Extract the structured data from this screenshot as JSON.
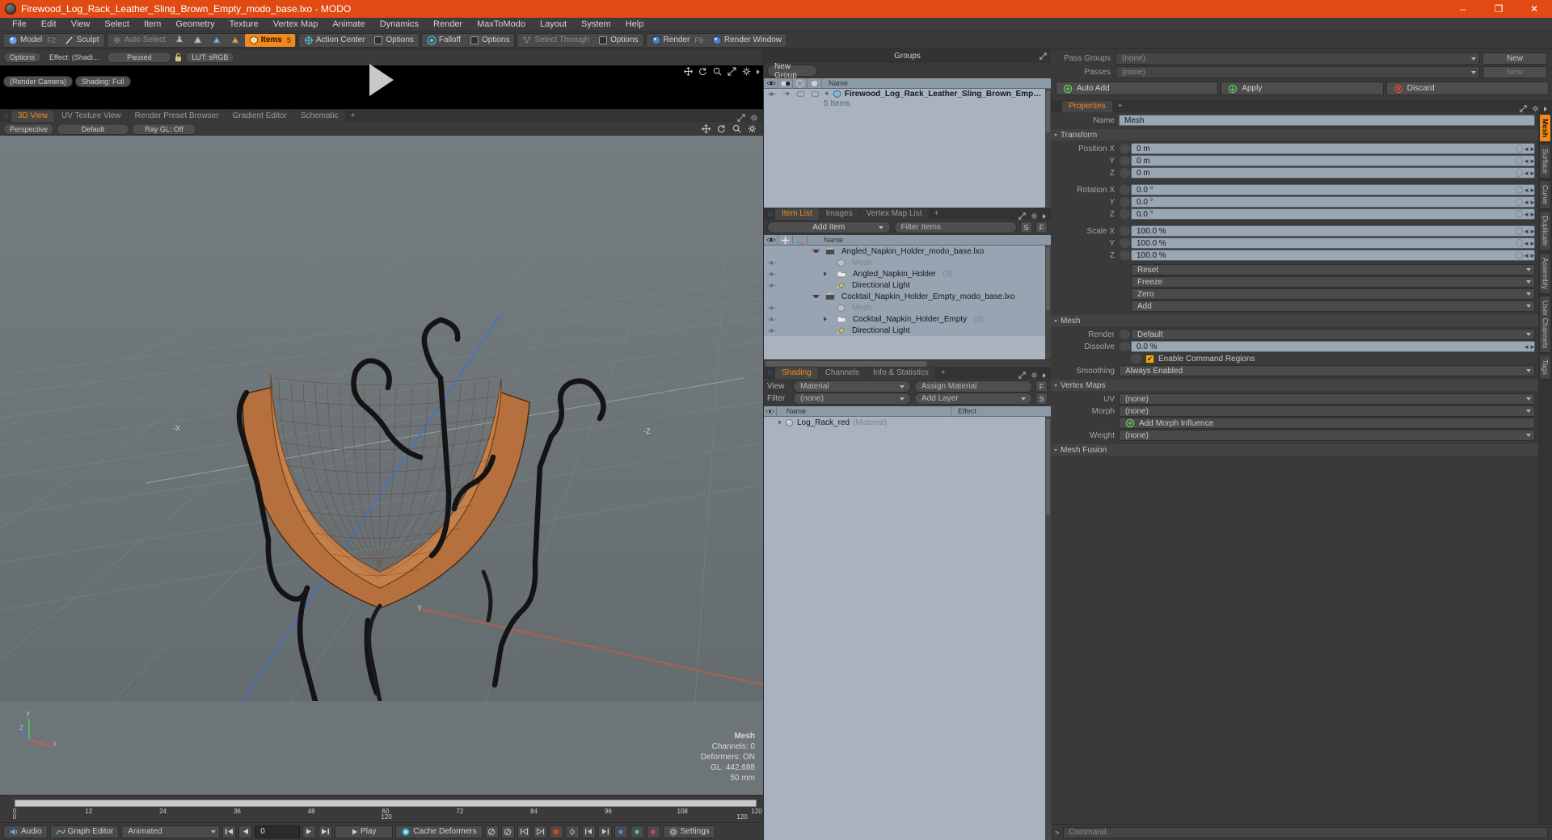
{
  "window": {
    "title": "Firewood_Log_Rack_Leather_Sling_Brown_Empty_modo_base.lxo - MODO",
    "minimize": "–",
    "maximize": "❐",
    "close": "✕"
  },
  "menubar": [
    "File",
    "Edit",
    "View",
    "Select",
    "Item",
    "Geometry",
    "Texture",
    "Vertex Map",
    "Animate",
    "Dynamics",
    "Render",
    "MaxToModo",
    "Layout",
    "System",
    "Help"
  ],
  "toolbar": {
    "model": "Model",
    "model_key": "F2",
    "sculpt": "Sculpt",
    "auto_select": "Auto Select",
    "items": "Items",
    "items_count": "5",
    "action_center": "Action Center",
    "options1": "Options",
    "falloff": "Falloff",
    "options2": "Options",
    "select_through": "Select Through",
    "options3": "Options",
    "render": "Render",
    "render_key": "F9",
    "render_window": "Render Window"
  },
  "preview": {
    "options": "Options",
    "effect": "Effect: (Shadi...",
    "paused": "Paused",
    "lut": "LUT: sRGB",
    "render_camera": "(Render Camera)",
    "shading": "Shading: Full"
  },
  "viewport": {
    "tabs": [
      {
        "label": "3D View",
        "active": true
      },
      {
        "label": "UV Texture View",
        "active": false
      },
      {
        "label": "Render Preset Browser",
        "active": false
      },
      {
        "label": "Gradient Editor",
        "active": false
      },
      {
        "label": "Schematic",
        "active": false
      },
      {
        "label": "+",
        "active": false
      }
    ],
    "perspective": "Perspective",
    "default": "Default",
    "raygl": "Ray GL: Off",
    "hud": {
      "title": "Mesh",
      "channels": "Channels: 0",
      "deformers": "Deformers: ON",
      "gl": "GL: 442,688",
      "scale": "50 mm"
    },
    "axis": {
      "x": "X",
      "y": "Y",
      "z": "Z"
    },
    "viewport_marks": {
      "left": "-X",
      "right": "-Z",
      "bottom": "Y"
    },
    "ruler_ticks": [
      "0",
      "12",
      "24",
      "36",
      "48",
      "60",
      "72",
      "84",
      "96",
      "108",
      "120"
    ],
    "ruler_labels": [
      "0",
      "120",
      "120"
    ]
  },
  "groups_panel": {
    "title": "Groups",
    "new_group": "New Group",
    "columns": [
      "eye-icon",
      "camera-icon",
      "box-wire-icon",
      "box-shade-icon",
      "Name"
    ],
    "rows": [
      {
        "name": "Firewood_Log_Rack_Leather_Sling_Brown_Emp…",
        "sub": "5 Items"
      }
    ]
  },
  "item_list": {
    "tabs": [
      {
        "label": "Item List",
        "active": true
      },
      {
        "label": "Images",
        "active": false
      },
      {
        "label": "Vertex Map List",
        "active": false
      },
      {
        "label": "+",
        "active": false
      }
    ],
    "add_item": "Add Item",
    "filter_placeholder": "Filter Items",
    "btn_s": "S",
    "btn_f": "F",
    "columns": [
      "eye-icon",
      "move-icon",
      "axis-icon",
      "Name"
    ],
    "rows": [
      {
        "name": "Angled_Napkin_Holder_modo_base.lxo",
        "icon": "scene-icon",
        "indent": 0,
        "arrow": "down",
        "count": "",
        "dim": false,
        "eye": false
      },
      {
        "name": "Mesh",
        "icon": "mesh-icon",
        "indent": 1,
        "arrow": "none",
        "count": "",
        "dim": true,
        "eye": true
      },
      {
        "name": "Angled_Napkin_Holder",
        "icon": "group-icon",
        "indent": 1,
        "arrow": "right",
        "count": "(3)",
        "dim": false,
        "eye": true
      },
      {
        "name": "Directional Light",
        "icon": "light-icon",
        "indent": 1,
        "arrow": "none",
        "count": "",
        "dim": false,
        "eye": true
      },
      {
        "name": "Cocktail_Napkin_Holder_Empty_modo_base.lxo",
        "icon": "scene-icon",
        "indent": 0,
        "arrow": "down",
        "count": "",
        "dim": false,
        "eye": false
      },
      {
        "name": "Mesh",
        "icon": "mesh-icon",
        "indent": 1,
        "arrow": "none",
        "count": "",
        "dim": true,
        "eye": true
      },
      {
        "name": "Cocktail_Napkin_Holder_Empty",
        "icon": "group-icon",
        "indent": 1,
        "arrow": "right",
        "count": "(2)",
        "dim": false,
        "eye": true
      },
      {
        "name": "Directional Light",
        "icon": "light-icon",
        "indent": 1,
        "arrow": "none",
        "count": "",
        "dim": false,
        "eye": true
      }
    ]
  },
  "shading_panel": {
    "tabs": [
      {
        "label": "Shading",
        "active": true
      },
      {
        "label": "Channels",
        "active": false
      },
      {
        "label": "Info & Statistics",
        "active": false
      },
      {
        "label": "+",
        "active": false
      }
    ],
    "view_label": "View",
    "view_value": "Material",
    "filter_label": "Filter",
    "filter_value": "(none)",
    "assign_material": "Assign Material",
    "add_layer": "Add Layer",
    "btn_f": "F",
    "btn_s": "S",
    "columns": [
      "Name",
      "Effect"
    ],
    "rows": [
      {
        "name": "Log_Rack_red",
        "type": "(Material)",
        "effect": ""
      }
    ]
  },
  "properties": {
    "pass_groups_label": "Pass Groups",
    "pass_groups_value": "(none)",
    "pass_groups_new": "New",
    "passes_label": "Passes",
    "passes_value": "(none)",
    "passes_new": "New",
    "auto_add": "Auto Add",
    "apply": "Apply",
    "discard": "Discard",
    "tabs": [
      {
        "label": "Properties",
        "active": true
      },
      {
        "label": "+",
        "active": false
      }
    ],
    "name_label": "Name",
    "name_value": "Mesh",
    "transform_section": "Transform",
    "position": {
      "label": "Position X",
      "x": "0 m",
      "y": "0 m",
      "z": "0 m",
      "ly": "Y",
      "lz": "Z"
    },
    "rotation": {
      "label": "Rotation X",
      "x": "0.0 °",
      "y": "0.0 °",
      "z": "0.0 °",
      "ly": "Y",
      "lz": "Z"
    },
    "scale": {
      "label": "Scale X",
      "x": "100.0 %",
      "y": "100.0 %",
      "z": "100.0 %",
      "ly": "Y",
      "lz": "Z"
    },
    "xform_menus": [
      "Reset",
      "Freeze",
      "Zero",
      "Add"
    ],
    "mesh_section": "Mesh",
    "render_label": "Render",
    "render_value": "Default",
    "dissolve_label": "Dissolve",
    "dissolve_value": "0.0 %",
    "enable_command_regions": "Enable Command Regions",
    "smoothing_label": "Smoothing",
    "smoothing_value": "Always Enabled",
    "vertex_maps_section": "Vertex Maps",
    "uv_label": "UV",
    "uv_value": "(none)",
    "morph_label": "Morph",
    "morph_value": "(none)",
    "add_morph_influence": "Add Morph Influence",
    "weight_label": "Weight",
    "weight_value": "(none)",
    "mesh_fusion_section": "Mesh Fusion",
    "vtabs": [
      {
        "label": "Mesh",
        "active": true
      },
      {
        "label": "Surface",
        "active": false
      },
      {
        "label": "Curve",
        "active": false
      },
      {
        "label": "Duplicate",
        "active": false
      },
      {
        "label": "Assembly",
        "active": false
      },
      {
        "label": "User Channels",
        "active": false
      },
      {
        "label": "Tags",
        "active": false
      }
    ]
  },
  "bottombar": {
    "audio": "Audio",
    "graph_editor": "Graph Editor",
    "animated": "Animated",
    "frame": "0",
    "play": "Play",
    "cache_deformers": "Cache Deformers",
    "settings": "Settings"
  },
  "command_bar": {
    "placeholder": "Command",
    "prompt": ">"
  },
  "colors": {
    "accent": "#f08a1e",
    "title_bar": "#e24a14",
    "list_bg": "#a8b3bf",
    "panel_bg": "#3a3a3a"
  }
}
